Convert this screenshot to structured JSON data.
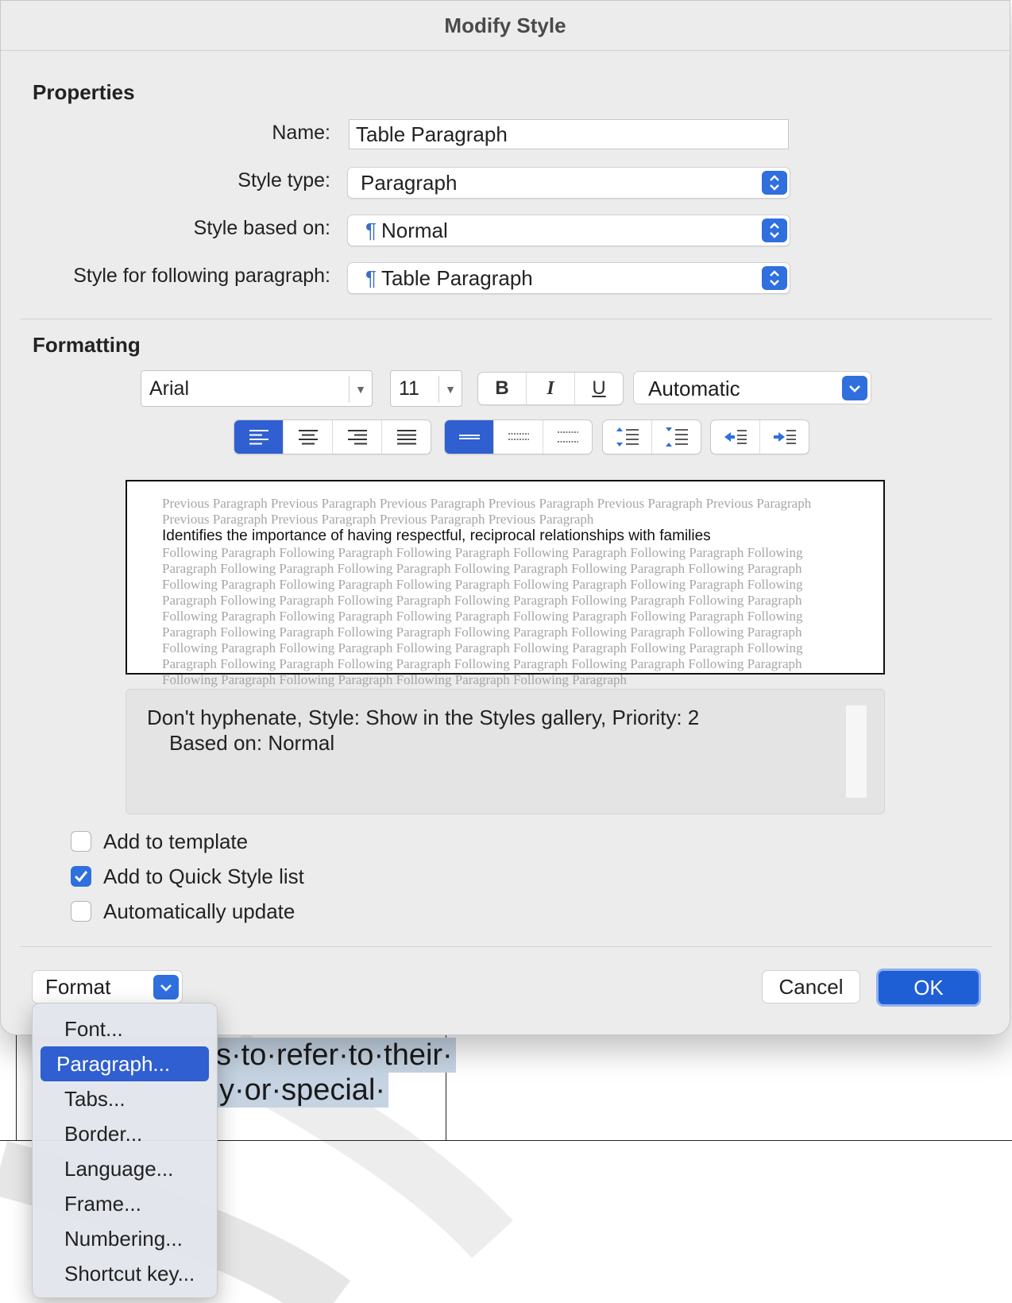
{
  "dialog": {
    "title": "Modify Style",
    "properties": {
      "section_title": "Properties",
      "name_label": "Name:",
      "name_value": "Table Paragraph",
      "style_type_label": "Style type:",
      "style_type_value": "Paragraph",
      "based_on_label": "Style based on:",
      "based_on_value": "Normal",
      "following_label": "Style for following paragraph:",
      "following_value": "Table Paragraph",
      "paragraph_mark": "¶"
    },
    "formatting": {
      "section_title": "Formatting",
      "font": "Arial",
      "size": "11",
      "bold": "B",
      "italic": "I",
      "underline": "U",
      "color": "Automatic",
      "alignment_selected": "left",
      "spacing_selected": "single"
    },
    "preview": {
      "previous_text": "Previous Paragraph Previous Paragraph Previous Paragraph Previous Paragraph Previous Paragraph Previous Paragraph Previous Paragraph Previous Paragraph Previous Paragraph Previous Paragraph",
      "sample_text": "Identifies the importance of having respectful, reciprocal relationships with families",
      "following_text": "Following Paragraph Following Paragraph Following Paragraph Following Paragraph Following Paragraph Following Paragraph Following Paragraph Following Paragraph Following Paragraph Following Paragraph Following Paragraph Following Paragraph Following Paragraph Following Paragraph Following Paragraph Following Paragraph Following Paragraph Following Paragraph Following Paragraph Following Paragraph Following Paragraph Following Paragraph Following Paragraph Following Paragraph Following Paragraph Following Paragraph Following Paragraph Following Paragraph Following Paragraph Following Paragraph Following Paragraph Following Paragraph Following Paragraph Following Paragraph Following Paragraph Following Paragraph Following Paragraph Following Paragraph Following Paragraph Following Paragraph Following Paragraph Following Paragraph Following Paragraph Following Paragraph Following Paragraph Following Paragraph Following Paragraph Following Paragraph"
    },
    "description": {
      "line1": "Don't hyphenate, Style: Show in the Styles gallery, Priority: 2",
      "line2": "Based on: Normal"
    },
    "options": {
      "add_to_template": "Add to template",
      "add_to_template_checked": false,
      "quick_style": "Add to Quick Style list",
      "quick_style_checked": true,
      "auto_update": "Automatically update",
      "auto_update_checked": false
    },
    "buttons": {
      "format": "Format",
      "cancel": "Cancel",
      "ok": "OK"
    },
    "format_menu": {
      "items": [
        "Font...",
        "Paragraph...",
        "Tabs...",
        "Border...",
        "Language...",
        "Frame...",
        "Numbering...",
        "Shortcut key..."
      ],
      "selected": "Paragraph..."
    }
  },
  "document": {
    "line1": "s·to·refer·to·their·",
    "line2": "y·or·special·"
  },
  "colors": {
    "accent": "#2f6fde",
    "selection": "#2f5fd0",
    "dialog_bg": "#ececec",
    "doc_highlight": "#c5d3e2"
  }
}
